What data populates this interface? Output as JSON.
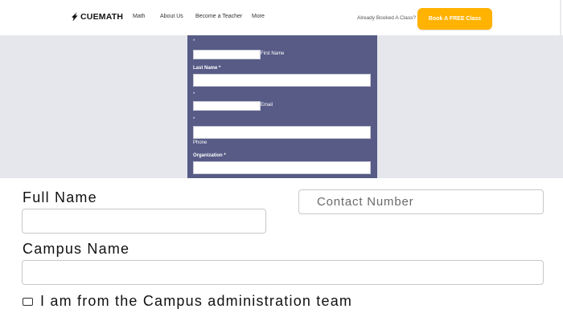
{
  "header": {
    "logo_text": "CUEMATH",
    "nav": [
      "Math",
      "About Us",
      "Become a Teacher",
      "More"
    ],
    "already_booked": "Already Booked A Class?",
    "cta": "Book A FREE Class",
    "cta_color": "#ffb200"
  },
  "embedded_form": {
    "panel_color": "#575b86",
    "required_marker": "*",
    "first_name_label": "First Name",
    "last_name_label": "Last Name *",
    "email_label": "Email",
    "phone_label": "Phone",
    "organization_label": "Organization *"
  },
  "campus_form": {
    "full_name_label": "Full Name",
    "contact_placeholder": "Contact Number",
    "campus_name_label": "Campus Name",
    "admin_checkbox_label": "I am from the Campus administration team"
  }
}
